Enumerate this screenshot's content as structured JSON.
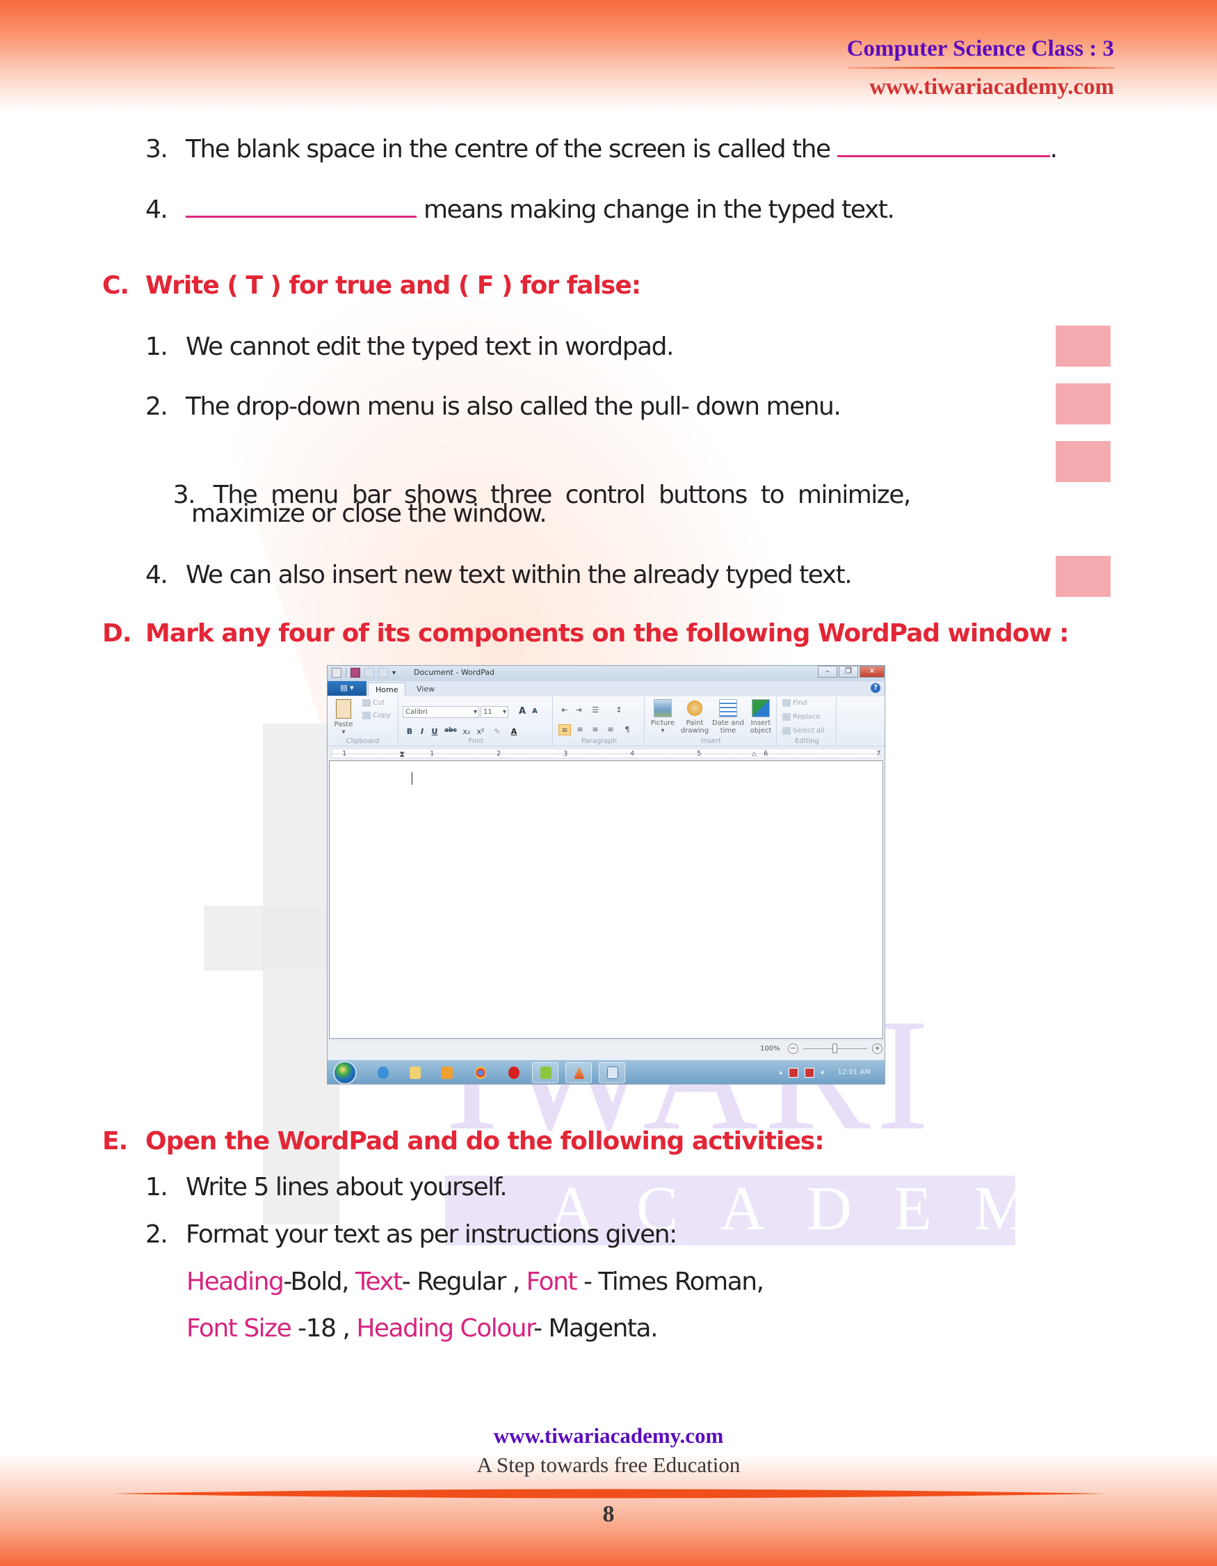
{
  "header": {
    "class_title": "Computer Science Class : 3",
    "website": "www.tiwariacademy.com"
  },
  "section_b_continued": {
    "items": [
      {
        "number": "3.",
        "text_before": "The blank space in the centre of the screen is called the",
        "text_after": "."
      },
      {
        "number": "4.",
        "text_before": "",
        "text_after": "means making change in the typed text."
      }
    ]
  },
  "section_c": {
    "letter": "C.",
    "heading": "Write ( T ) for true and ( F ) for false:",
    "items": [
      {
        "number": "1.",
        "text": "We cannot edit the typed text in wordpad."
      },
      {
        "number": "2.",
        "text": "The drop-down menu is also called the pull- down menu."
      },
      {
        "number": "3.",
        "text": "The  menu  bar  shows  three  control  buttons  to  minimize,",
        "text_cont": "maximize or close the window."
      },
      {
        "number": "4.",
        "text": "We can also insert new text within the already typed text."
      }
    ],
    "answer_box_color": "#f5aab0"
  },
  "section_d": {
    "letter": "D.",
    "heading": "Mark any four of its components on the following WordPad window :"
  },
  "wordpad": {
    "title": "Document - WordPad",
    "window_buttons": {
      "minimize": "–",
      "restore": "❐",
      "close": "✕"
    },
    "app_menu_label": "▤ ▾",
    "tabs": [
      {
        "label": "Home",
        "active": true
      },
      {
        "label": "View",
        "active": false
      }
    ],
    "help_label": "?",
    "clipboard": {
      "paste": "Paste",
      "paste_arrow": "▾",
      "cut": "Cut",
      "copy": "Copy",
      "group_label": "Clipboard"
    },
    "font": {
      "family": "Calibri",
      "size": "11",
      "grow": "A",
      "shrink": "A",
      "bold": "B",
      "italic": "I",
      "underline": "U",
      "strikethrough": "abc",
      "subscript": "x₂",
      "superscript": "x²",
      "highlight": "✎",
      "color": "A",
      "group_label": "Font"
    },
    "paragraph": {
      "group_label": "Paragraph",
      "buttons": [
        "⇤",
        "⇥",
        "☰",
        "↕",
        "≡",
        "≡",
        "≡",
        "≡",
        "¶"
      ]
    },
    "insert": {
      "group_label": "Insert",
      "buttons": [
        {
          "label": "Picture",
          "sub": "▾"
        },
        {
          "label": "Paint",
          "sub": "drawing"
        },
        {
          "label": "Date and",
          "sub": "time"
        },
        {
          "label": "Insert",
          "sub": "object"
        }
      ]
    },
    "editing": {
      "group_label": "Editing",
      "find": "Find",
      "replace": "Replace",
      "select_all": "Select all"
    },
    "ruler_numbers": [
      "1",
      "1",
      "2",
      "3",
      "4",
      "5",
      "6",
      "7"
    ],
    "zoom_level": "100%",
    "zoom_fraction": 0.5,
    "zoom_minus": "−",
    "zoom_plus": "+",
    "clock": "12:01 AM",
    "tray_arrow": "▴"
  },
  "section_e": {
    "letter": "E.",
    "heading": "Open the WordPad and do the following activities:",
    "items": [
      {
        "number": "1.",
        "text": "Write 5 lines about yourself."
      },
      {
        "number": "2.",
        "text": "Format your text as per instructions given:"
      }
    ],
    "format_line1": [
      {
        "text": "Heading",
        "highlight": true
      },
      {
        "text": "-Bold, ",
        "highlight": false
      },
      {
        "text": "Text",
        "highlight": true
      },
      {
        "text": "- Regular , ",
        "highlight": false
      },
      {
        "text": "Font",
        "highlight": true
      },
      {
        "text": " - Times Roman,",
        "highlight": false
      }
    ],
    "format_line2": [
      {
        "text": "Font Size",
        "highlight": true
      },
      {
        "text": " -18 , ",
        "highlight": false
      },
      {
        "text": "Heading Colour",
        "highlight": true
      },
      {
        "text": "- Magenta.",
        "highlight": false
      }
    ],
    "highlight_color": "#d6247f"
  },
  "watermark": {
    "word1": "IWARI",
    "word2": "ACADEMY"
  },
  "footer": {
    "website": "www.tiwariacademy.com",
    "tagline": "A Step towards free Education",
    "page_number": "8"
  }
}
